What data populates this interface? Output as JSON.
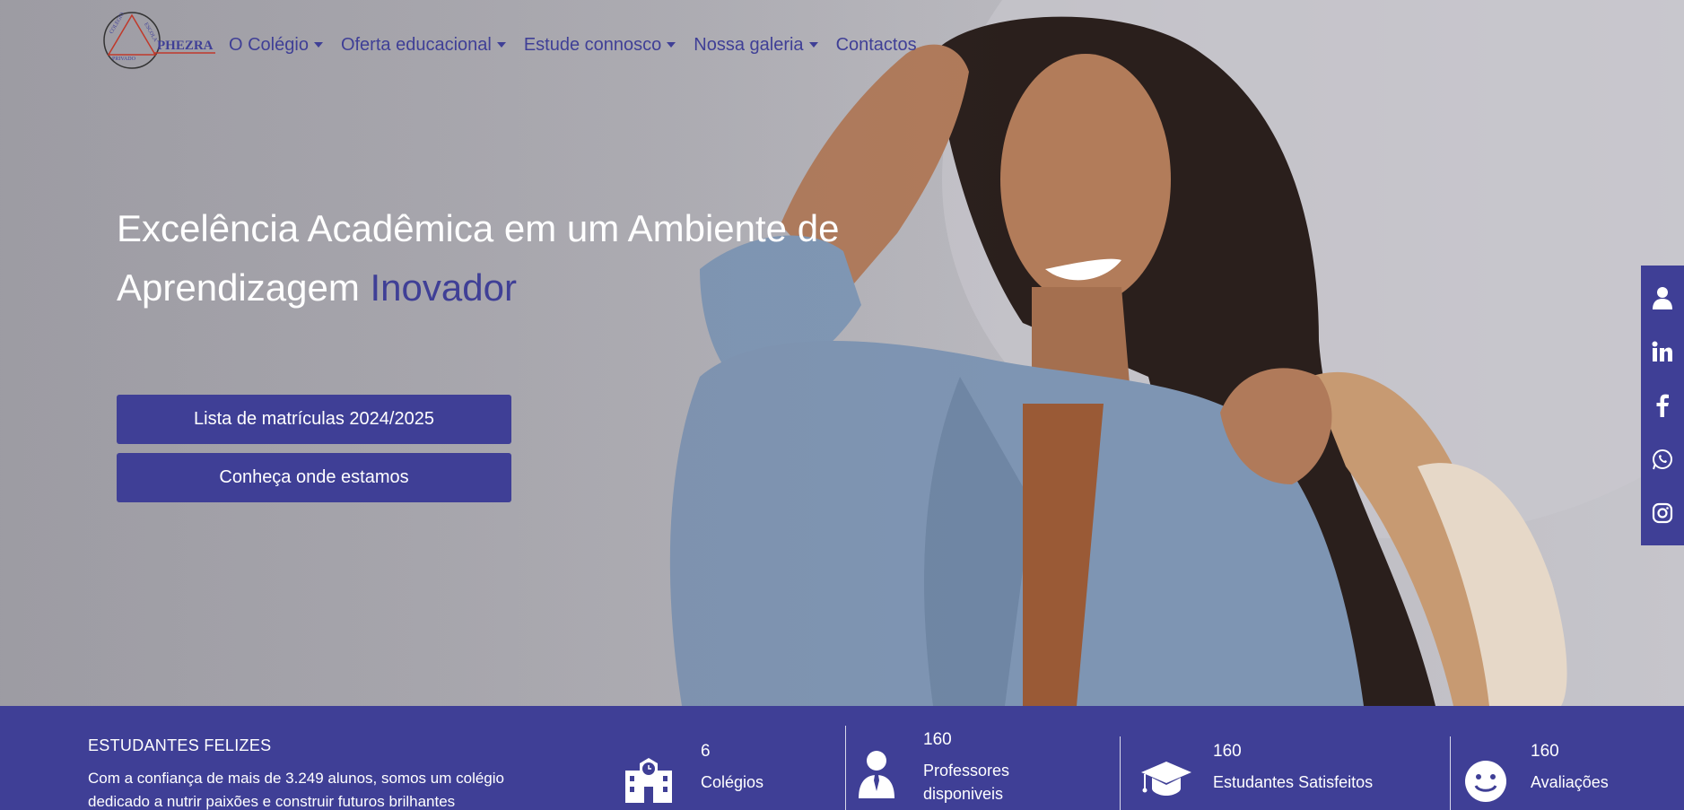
{
  "nav": {
    "logo_text": "PHEZRA",
    "logo_ring_top": "COLEGIO",
    "logo_ring_right": "ESCOLA",
    "logo_ring_bottom": "PRIVADO",
    "items": [
      {
        "label": "O Colégio",
        "dropdown": true
      },
      {
        "label": "Oferta educacional",
        "dropdown": true
      },
      {
        "label": "Estude connosco",
        "dropdown": true
      },
      {
        "label": "Nossa galeria",
        "dropdown": true
      },
      {
        "label": "Contactos",
        "dropdown": false
      }
    ]
  },
  "hero": {
    "headline_part1": "Excelência Acadêmica em um Ambiente de",
    "headline_part2": "Aprendizagem",
    "headline_accent": "Inovador",
    "buttons": [
      {
        "label": "Lista de matrículas 2024/2025"
      },
      {
        "label": "Conheça onde estamos"
      }
    ]
  },
  "social": [
    "user-icon",
    "linkedin-icon",
    "facebook-icon",
    "whatsapp-icon",
    "instagram-icon"
  ],
  "stats": {
    "title": "ESTUDANTES FELIZES",
    "description": "Com a confiança de mais de 3.249 alunos, somos um colégio dedicado a nutrir paixões e construir futuros brilhantes",
    "items": [
      {
        "value": "6",
        "label": "Colégios",
        "icon": "school-icon"
      },
      {
        "value": "160",
        "label": "Professores disponiveis",
        "icon": "teacher-icon"
      },
      {
        "value": "160",
        "label": "Estudantes Satisfeitos",
        "icon": "graduation-cap-icon"
      },
      {
        "value": "160",
        "label": "Avaliações",
        "icon": "smiley-icon"
      }
    ]
  },
  "colors": {
    "brand": "#3f3f96",
    "hero_text": "#ffffff"
  }
}
